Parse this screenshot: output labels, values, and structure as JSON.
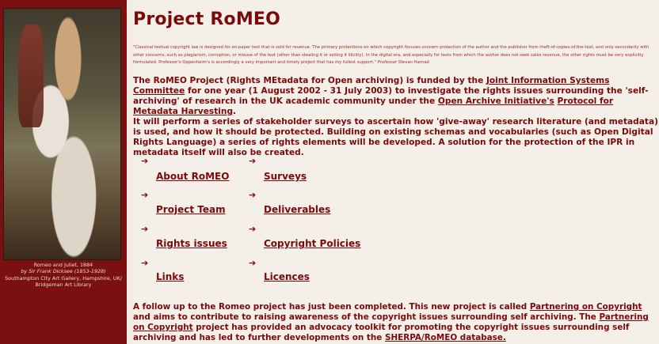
{
  "sidebar": {
    "caption": {
      "line1": "Romeo and Juliet, 1884",
      "line2": "by Sir Frank Dicksee (1853-1928)",
      "line3": "Southampton City Art Gallery, Hampshire, UK/",
      "line4": "Bridgeman Art Library"
    }
  },
  "main": {
    "title": "Project RoMEO",
    "quote": {
      "text": "\"Classical textual copyright law is designed for on-paper text that is sold for revenue. The primary protections on which copyright focuses concern protection of the author and the publisher from theft-of-copies-of-the-text, and only secondarily with other concerns, such as plagiarism, corruption, or misuse of the text (other than stealing it or selling it illicitly).   In the digital era, and especially for texts from which the author does not seek sales revenue, the other rights must be very explicitly formulated. Professor's Oppenheim's is accordingly a very important and timely project that has my fullest support.\"",
      "attribution": "Professor Stevan Harnad"
    },
    "para1": {
      "t1": "The RoMEO Project (Rights MEtadata for Open archiving)  is funded by the ",
      "link1": "Joint Information Systems Committee",
      "t2": " for one year (1 August 2002 - 31 July 2003) to investigate the rights issues surrounding the 'self-archiving' of research in the UK academic community under the ",
      "link2": "Open Archive Initiative's",
      "t3": " ",
      "link3": "Protocol for Metadata Harvesting",
      "t4": "."
    },
    "para2": "It will perform a series of stakeholder surveys to ascertain how 'give-away' research literature (and metadata) is used, and how it should be protected. Building on existing schemas and vocabularies (such as Open Digital Rights Language) a series of rights elements will be developed. A solution for the protection of the IPR in metadata itself will also be created.",
    "menu": {
      "arrow": "➔",
      "about": "About RoMEO",
      "surveys": "Surveys ",
      "team": "Project Team",
      "deliverables": "Deliverables",
      "rights": "Rights issues",
      "copyright": "Copyright Policies",
      "links": "Links",
      "licences": "Licences"
    },
    "followup": {
      "t1": "A follow up to the Romeo project has just been completed. This new project is called ",
      "link1": "Partnering on Copyright",
      "t2": " and aims to contribute to raising awareness of the copyright issues surrounding self archiving. The ",
      "link2": "Partnering on Copyright",
      "t3": " project has provided an advocacy toolkit for promoting the copyright issues surrounding self archiving and has led to further developments on the ",
      "link3": "SHERPA/RoMEO database."
    }
  }
}
